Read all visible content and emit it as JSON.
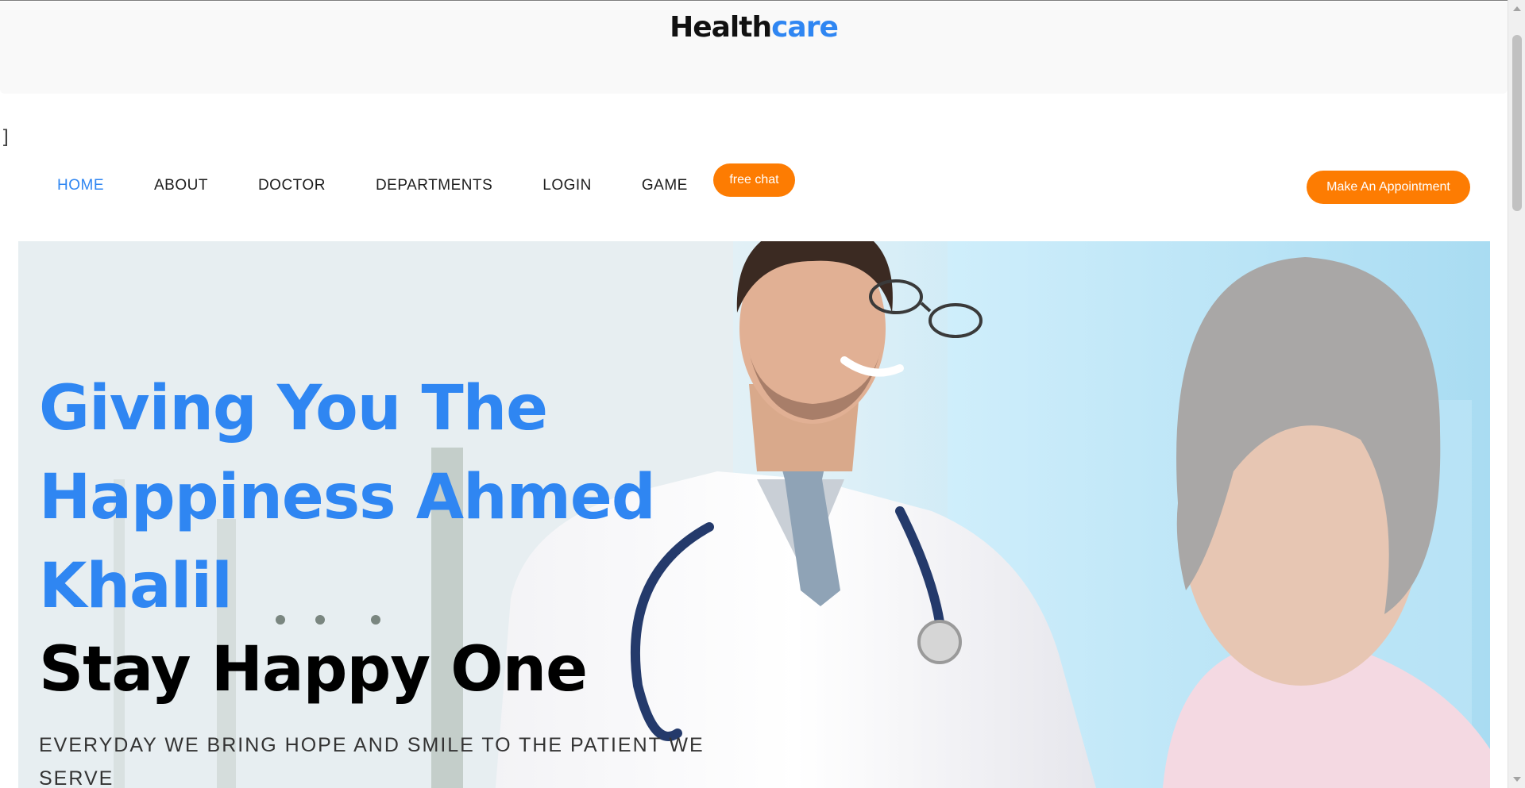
{
  "brand": {
    "part1": "Health",
    "part2": "care",
    "accent_color": "#2f86f2"
  },
  "stray_text": "]",
  "nav": {
    "items": [
      {
        "label": "HOME",
        "active": true
      },
      {
        "label": "ABOUT",
        "active": false
      },
      {
        "label": "DOCTOR",
        "active": false
      },
      {
        "label": "DEPARTMENTS",
        "active": false
      },
      {
        "label": "LOGIN",
        "active": false
      },
      {
        "label": "GAME",
        "active": false
      }
    ],
    "chat_label": "free chat",
    "appointment_label": "Make An Appointment",
    "button_color": "#fd7c02"
  },
  "hero": {
    "title": "Giving You The Happiness Ahmed Khalil",
    "subtitle": "Stay Happy One",
    "tagline": "EVERYDAY WE BRING HOPE AND SMILE TO THE PATIENT WE SERVE",
    "image_subject": "doctor-with-patient-photo"
  }
}
